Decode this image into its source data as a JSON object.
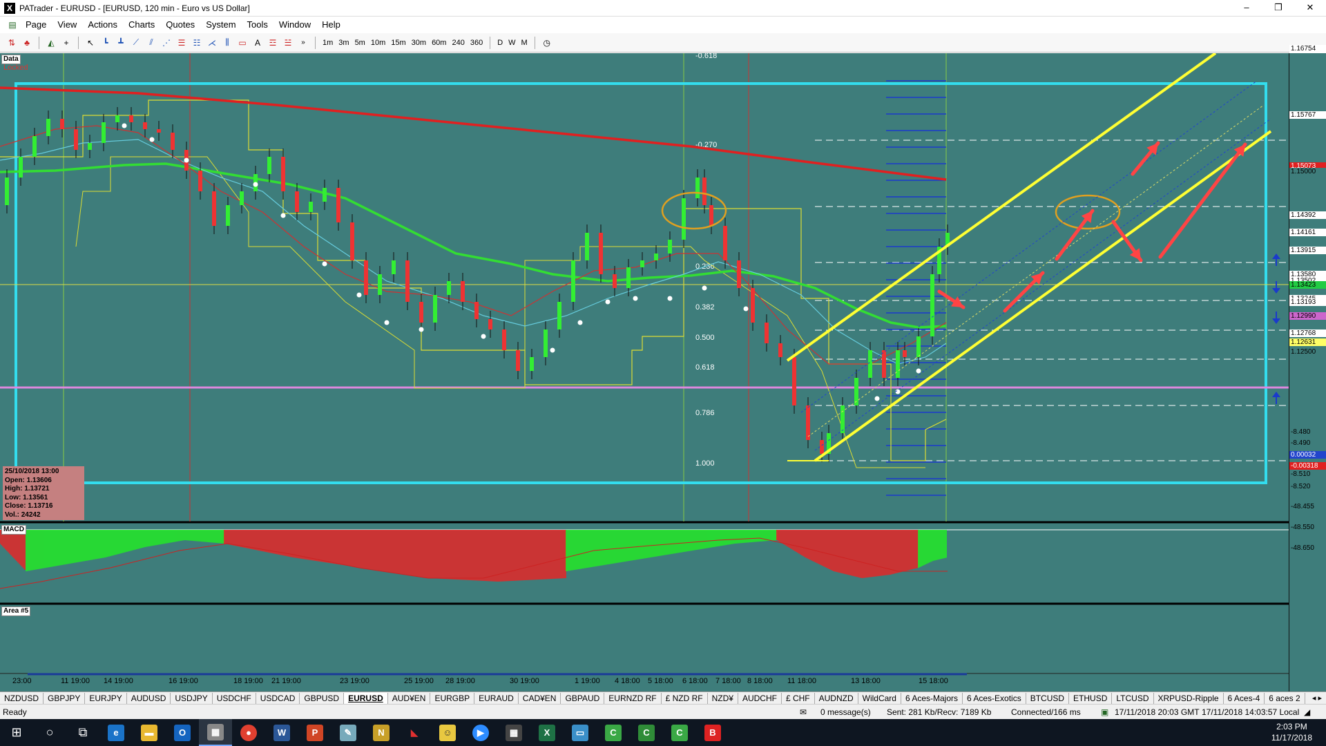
{
  "window": {
    "app_icon": "X",
    "title": "PATrader - EURUSD - [EURUSD, 120 min - Euro vs US Dollar]",
    "controls": [
      "–",
      "❐",
      "✕"
    ],
    "mdi_controls": [
      "–",
      "❐",
      "✕"
    ]
  },
  "menu": [
    "Page",
    "View",
    "Actions",
    "Charts",
    "Quotes",
    "System",
    "Tools",
    "Window",
    "Help"
  ],
  "toolbar": {
    "timeframes": [
      "1m",
      "3m",
      "5m",
      "10m",
      "15m",
      "30m",
      "60m",
      "240",
      "360"
    ],
    "periods": [
      "D",
      "W",
      "M"
    ],
    "more": "»"
  },
  "chart": {
    "pane_label_main": "Data",
    "locked_label": "Locked",
    "pane_label_macd": "MACD",
    "pane_label_area": "Area #5",
    "info": {
      "date": "25/10/2018 13:00",
      "open": "Open: 1.13606",
      "high": "High: 1.13721",
      "low": "Low: 1.13561",
      "close": "Close: 1.13716",
      "vol": "Vol.: 24242"
    },
    "fib_levels": [
      "-0.618",
      "-0.270",
      "0.236",
      "0.382",
      "0.500",
      "0.618",
      "0.786",
      "1.000"
    ],
    "price_labels": [
      {
        "text": "1.16754",
        "color": "#ffffff"
      },
      {
        "text": "1.15767",
        "color": "#ffffff"
      },
      {
        "text": "1.15073",
        "color": "#e02020"
      },
      {
        "text": "1.15000",
        "color": "#3e7d7b"
      },
      {
        "text": "1.14392",
        "color": "#ffffff"
      },
      {
        "text": "1.14161",
        "color": "#ffffff"
      },
      {
        "text": "1.13915",
        "color": "#ffffff"
      },
      {
        "text": "1.13580",
        "color": "#ffffff"
      },
      {
        "text": "1.13502",
        "color": "#ffffff"
      },
      {
        "text": "1.13423",
        "color": "#22cc44"
      },
      {
        "text": "1.13245",
        "color": "#ffffff"
      },
      {
        "text": "1.13193",
        "color": "#ffffff"
      },
      {
        "text": "1.12990",
        "color": "#cc66cc"
      },
      {
        "text": "1.12768",
        "color": "#ffffff"
      },
      {
        "text": "1.12631",
        "color": "#ffff66"
      },
      {
        "text": "1.12500",
        "color": "#3e7d7b"
      }
    ],
    "macd_labels": [
      {
        "text": "-8.480",
        "color": "#3e7d7b"
      },
      {
        "text": "-8.490",
        "color": "#3e7d7b"
      },
      {
        "text": "0.00032",
        "color": "#2244cc"
      },
      {
        "text": "-0.00318",
        "color": "#e02020"
      },
      {
        "text": "-8.510",
        "color": "#3e7d7b"
      },
      {
        "text": "-8.520",
        "color": "#3e7d7b"
      }
    ],
    "area_labels": [
      "-48.455",
      "-48.550",
      "-48.650"
    ],
    "time_labels": [
      "23:00",
      "11 19:00",
      "14 19:00",
      "16 19:00",
      "18 19:00",
      "21 19:00",
      "23 19:00",
      "25 19:00",
      "28 19:00",
      "30 19:00",
      "1 19:00",
      "4 18:00",
      "5 18:00",
      "6 18:00",
      "7 18:00",
      "8 18:00",
      "11 18:00",
      "13 18:00",
      "15 18:00"
    ],
    "colors": {
      "background": "#3e7d7b",
      "channel": "#ffff33",
      "ma200": "#e02020",
      "ma_green": "#33dd33",
      "box": "#33ddee",
      "arrows": "#ff4444"
    }
  },
  "symbol_tabs": [
    "NZDUSD",
    "GBPJPY",
    "EURJPY",
    "AUDUSD",
    "USDJPY",
    "USDCHF",
    "USDCAD",
    "GBPUSD",
    "EURUSD",
    "AUD¥EN",
    "EURGBP",
    "EURAUD",
    "CAD¥EN",
    "GBPAUD",
    "EURNZD RF",
    "£ NZD RF",
    "NZD¥",
    "AUDCHF",
    "£ CHF",
    "AUDNZD",
    "WildCard",
    "6 Aces-Majors",
    "6 Aces-Exotics",
    "BTCUSD",
    "ETHUSD",
    "LTCUSD",
    "XRPUSD-Ripple",
    "6 Aces-4",
    "6 aces 2"
  ],
  "active_tab": "EURUSD",
  "status": {
    "ready": "Ready",
    "messages": "0 message(s)",
    "sent": "Sent: 281 Kb/Recv: 7189 Kb",
    "connected": "Connected/166 ms",
    "gmt": "17/11/2018 20:03 GMT",
    "local": "17/11/2018 14:03:57 Local"
  },
  "taskbar": {
    "time": "2:03 PM",
    "date": "11/17/2018"
  }
}
